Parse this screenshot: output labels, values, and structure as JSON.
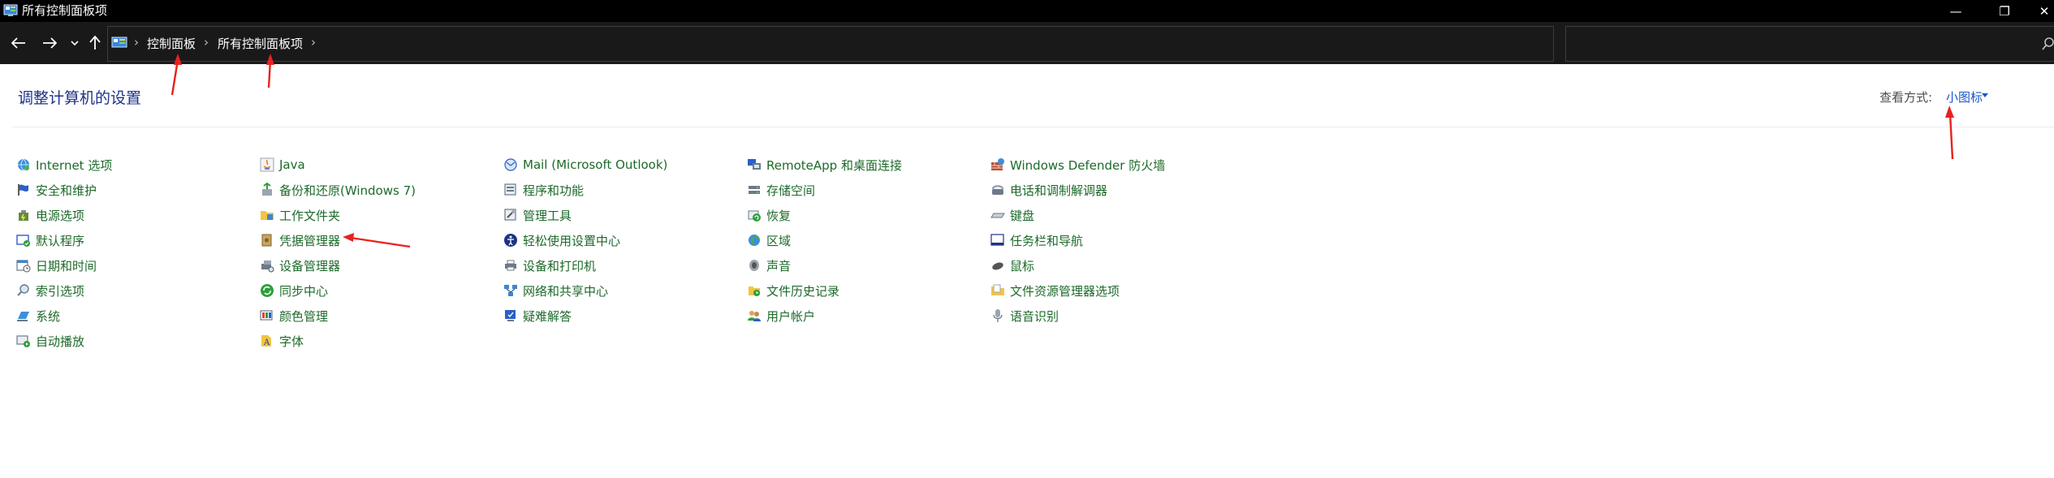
{
  "window": {
    "title": "所有控制面板项",
    "minimize": "—",
    "maximize": "❐",
    "close": "✕"
  },
  "nav": {
    "back_icon": "arrow-left",
    "forward_icon": "arrow-right",
    "recent_icon": "chevron-down",
    "up_icon": "arrow-up"
  },
  "address": {
    "breadcrumb": [
      "控制面板",
      "所有控制面板项"
    ],
    "separator": "›"
  },
  "search": {
    "value": "",
    "placeholder": ""
  },
  "content": {
    "title": "调整计算机的设置",
    "view_by_label": "查看方式:",
    "view_by_value": "小图标"
  },
  "columns": [
    [
      "Internet 选项",
      "安全和维护",
      "电源选项",
      "默认程序",
      "日期和时间",
      "索引选项",
      "系统",
      "自动播放"
    ],
    [
      "Java",
      "备份和还原(Windows 7)",
      "工作文件夹",
      "凭据管理器",
      "设备管理器",
      "同步中心",
      "颜色管理",
      "字体"
    ],
    [
      "Mail (Microsoft Outlook)",
      "程序和功能",
      "管理工具",
      "轻松使用设置中心",
      "设备和打印机",
      "网络和共享中心",
      "疑难解答"
    ],
    [
      "RemoteApp 和桌面连接",
      "存储空间",
      "恢复",
      "区域",
      "声音",
      "文件历史记录",
      "用户帐户"
    ],
    [
      "Windows Defender 防火墙",
      "电话和调制解调器",
      "键盘",
      "任务栏和导航",
      "鼠标",
      "文件资源管理器选项",
      "语音识别"
    ]
  ],
  "colors": {
    "titlebar": "#000000",
    "navbar": "#191919",
    "link_green": "#1d6a2a",
    "title_blue": "#1e3287",
    "accent_blue": "#1a55c9",
    "annotation_red": "#e8221e"
  }
}
